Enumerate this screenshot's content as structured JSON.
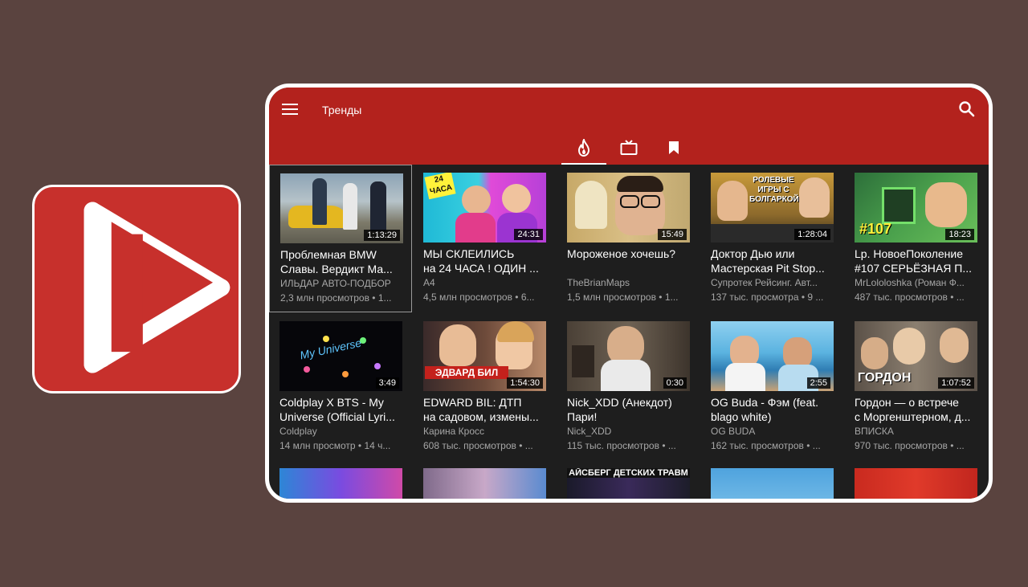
{
  "appbar": {
    "title": "Тренды",
    "menu_icon": "menu-icon",
    "search_icon": "search-icon",
    "color": "#b3221d"
  },
  "tabs": [
    {
      "name": "trending",
      "icon": "flame-icon",
      "active": true
    },
    {
      "name": "subscriptions",
      "icon": "tv-icon",
      "active": false
    },
    {
      "name": "saved",
      "icon": "bookmark-icon",
      "active": false
    }
  ],
  "videos": [
    {
      "title_line1": "Проблемная BMW",
      "title_line2": "Славы. Вердикт Ма...",
      "channel": "ИЛЬДАР АВТО-ПОДБОР",
      "meta": "2,3 млн просмотров • 1...",
      "duration": "1:13:29",
      "selected": true
    },
    {
      "title_line1": "МЫ СКЛЕИЛИСЬ",
      "title_line2": "на 24 ЧАСА ! ОДИН ...",
      "channel": "A4",
      "meta": "4,5 млн просмотров • 6...",
      "duration": "24:31",
      "thumb_text": "24 ЧАСА"
    },
    {
      "title_line1": "Мороженое хочешь?",
      "title_line2": "",
      "channel": "TheBrianMaps",
      "meta": "1,5 млн просмотров • 1...",
      "duration": "15:49"
    },
    {
      "title_line1": "Доктор Дью или",
      "title_line2": "Мастерская Pit Stop...",
      "channel": "Супротек Рейсинг. Авт...",
      "meta": "137 тыс. просмотра • 9 ...",
      "duration": "1:28:04",
      "thumb_text": "РОЛЕВЫЕ ИГРЫ С БОЛГАРКОЙ"
    },
    {
      "title_line1": "Lp. НовоеПоколение",
      "title_line2": "#107 СЕРЬЁЗНАЯ П...",
      "channel": "MrLololoshka (Роман Ф...",
      "meta": "487 тыс. просмотров • ...",
      "duration": "18:23",
      "thumb_text": "#107"
    },
    {
      "title_line1": "Coldplay X BTS - My",
      "title_line2": "Universe (Official Lyri...",
      "channel": "Coldplay",
      "meta": "14 млн просмотр • 14 ч...",
      "duration": "3:49",
      "thumb_text": "My Universe"
    },
    {
      "title_line1": "EDWARD BIL: ДТП",
      "title_line2": "на садовом, измены...",
      "channel": "Карина Кросс",
      "meta": "608 тыс. просмотров • ...",
      "duration": "1:54:30",
      "thumb_text": "ЭДВАРД БИЛ"
    },
    {
      "title_line1": "Nick_XDD (Анекдот)",
      "title_line2": "Пари!",
      "channel": "Nick_XDD",
      "meta": "115 тыс. просмотров • ...",
      "duration": "0:30"
    },
    {
      "title_line1": "OG Buda - Фэм (feat.",
      "title_line2": "blago white)",
      "channel": "OG BUDA",
      "meta": "162 тыс. просмотров • ...",
      "duration": "2:55"
    },
    {
      "title_line1": "Гордон — о встрече",
      "title_line2": "с Моргенштерном, д...",
      "channel": "ВПИСКА",
      "meta": "970 тыс. просмотров • ...",
      "duration": "1:07:52",
      "thumb_text": "ГОРДОН"
    }
  ],
  "partial_row_labels": [
    "",
    "",
    "АЙСБЕРГ ДЕТСКИХ ТРАВМ",
    "",
    ""
  ]
}
